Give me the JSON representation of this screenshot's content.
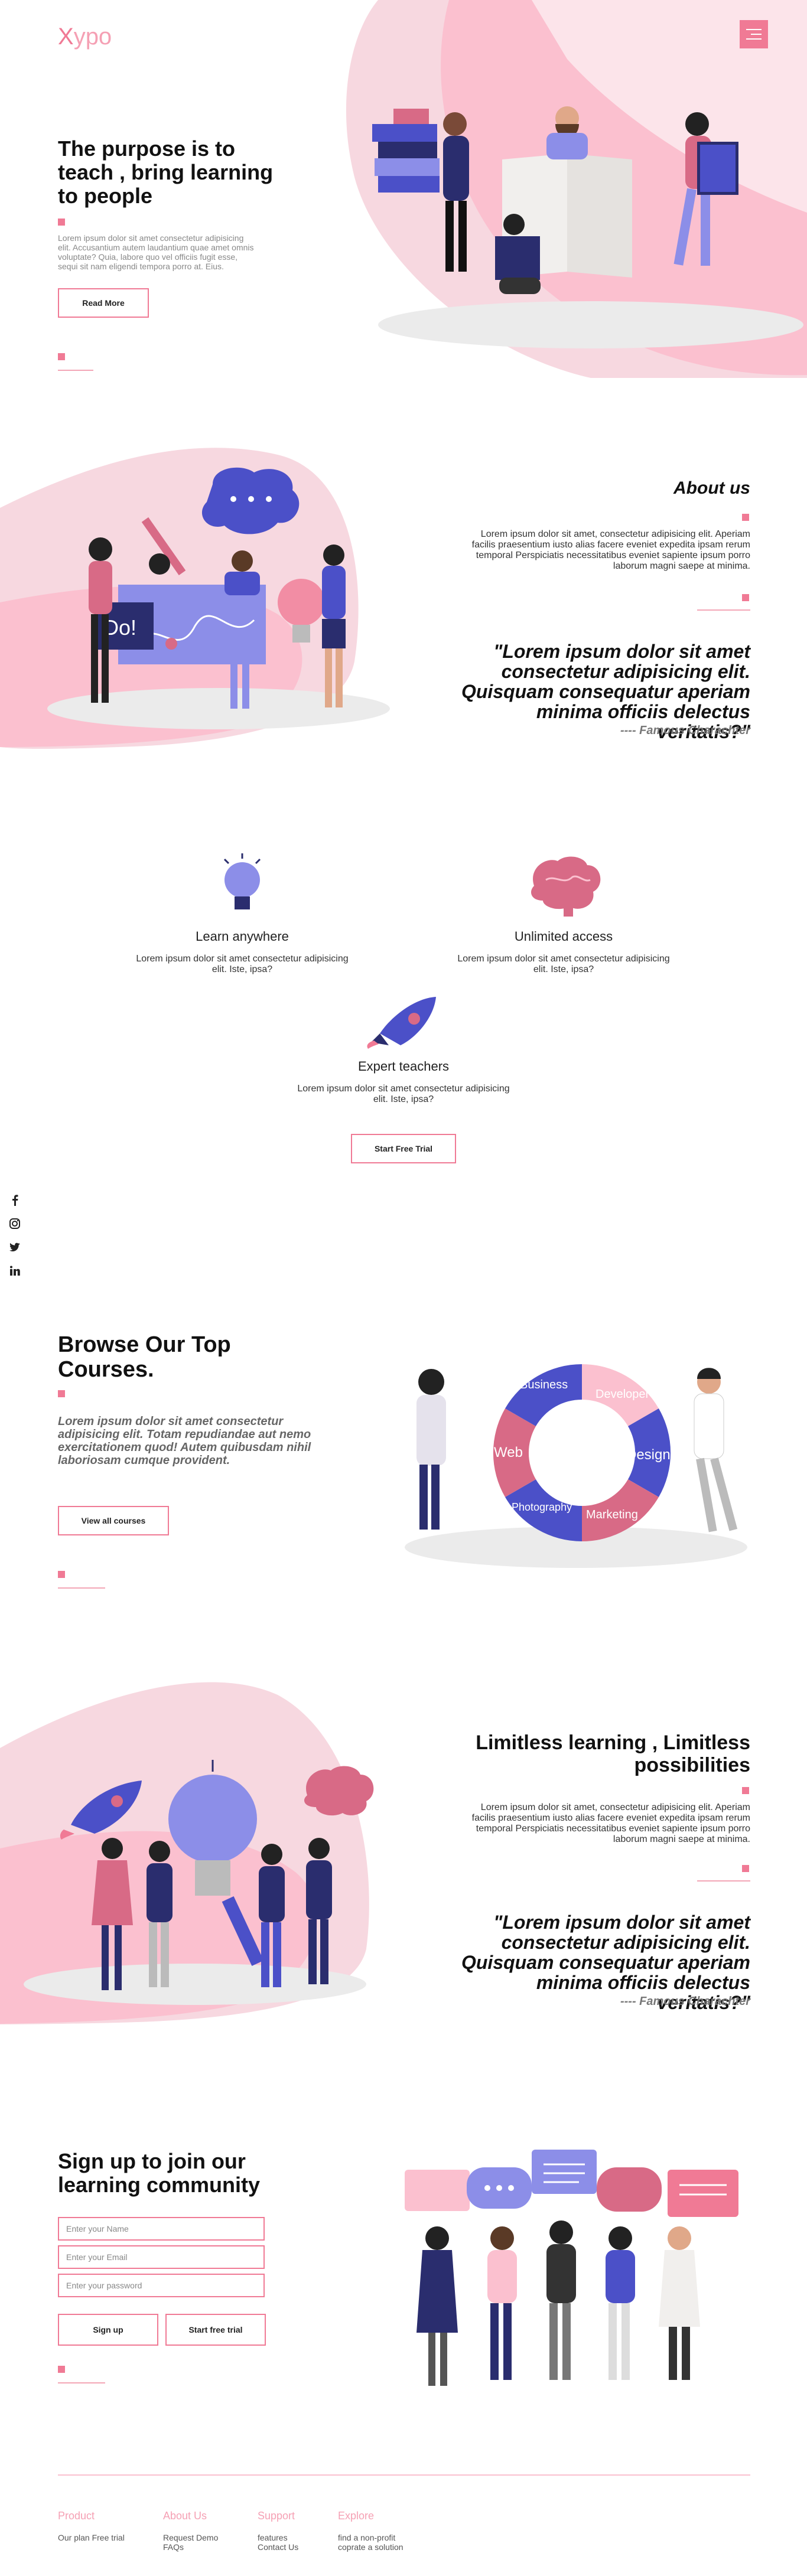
{
  "brand": {
    "logo_x": "X",
    "logo_rest": "ypo"
  },
  "hero": {
    "title": "The purpose is to teach , bring learning to people",
    "text": "Lorem ipsum dolor sit amet consectetur adipisicing elit. Accusantium autem laudantium quae amet omnis voluptate? Quia, labore quo vel officiis fugit esse, sequi sit nam eligendi tempora porro at. Eius.",
    "button": "Read More"
  },
  "about": {
    "title": "About us",
    "text": "Lorem ipsum dolor sit amet, consectetur adipisicing elit. Aperiam facilis praesentium iusto alias facere eveniet expedita ipsam rerum temporal Perspiciatis necessitatibus eveniet sapiente ipsum porro laborum magni saepe at minima.",
    "quote": "\"Lorem ipsum dolor sit amet consectetur adipisicing elit. Quisquam consequatur aperiam minima officiis delectus veritatis?\"",
    "author": "---- Famous Charachter"
  },
  "features": [
    {
      "title": "Learn anywhere",
      "text": "Lorem ipsum dolor sit amet consectetur adipisicing elit. Iste, ipsa?",
      "icon": "lightbulb-icon"
    },
    {
      "title": "Unlimited access",
      "text": "Lorem ipsum dolor sit amet consectetur adipisicing elit. Iste, ipsa?",
      "icon": "brain-icon"
    },
    {
      "title": "Expert teachers",
      "text": "Lorem ipsum dolor sit amet consectetur adipisicing elit. Iste, ipsa?",
      "icon": "rocket-icon"
    }
  ],
  "trial_button": "Start Free Trial",
  "social": [
    "facebook-icon",
    "instagram-icon",
    "twitter-icon",
    "linkedin-icon"
  ],
  "courses": {
    "title": "Browse Our Top Courses.",
    "text": "Lorem ipsum dolor sit amet consectetur adipisicing elit. Totam repudiandae aut nemo exercitationem quod! Autem quibusdam nihil laboriosam cumque provident.",
    "button": "View all courses",
    "wheel": [
      "Business",
      "Developer",
      "Design",
      "Marketing",
      "Photography",
      "Web"
    ]
  },
  "limitless": {
    "title": "Limitless learning , Limitless possibilities",
    "text": "Lorem ipsum dolor sit amet, consectetur adipisicing elit. Aperiam facilis praesentium iusto alias facere eveniet expedita ipsam rerum temporal Perspiciatis necessitatibus eveniet sapiente ipsum porro laborum magni saepe at minima.",
    "quote": "\"Lorem ipsum dolor sit amet consectetur adipisicing elit. Quisquam consequatur aperiam minima officiis delectus veritatis?\"",
    "author": "---- Famous Charachter"
  },
  "signup": {
    "title": "Sign up to join our learning community",
    "name_placeholder": "Enter your Name",
    "email_placeholder": "Enter your Email",
    "password_placeholder": "Enter your password",
    "signup_button": "Sign up",
    "trial_button": "Start free trial"
  },
  "footer": {
    "columns": [
      {
        "title": "Product",
        "links": [
          "Our plan Free trial"
        ]
      },
      {
        "title": "About Us",
        "links": [
          "Request Demo",
          "FAQs"
        ]
      },
      {
        "title": "Support",
        "links": [
          "features",
          "Contact Us"
        ]
      },
      {
        "title": "Explore",
        "links": [
          "find a non-profit",
          "coprate a solution"
        ]
      }
    ]
  },
  "colors": {
    "accent": "#f07a95",
    "purple": "#4b50c8",
    "navy": "#2a2d6e"
  }
}
